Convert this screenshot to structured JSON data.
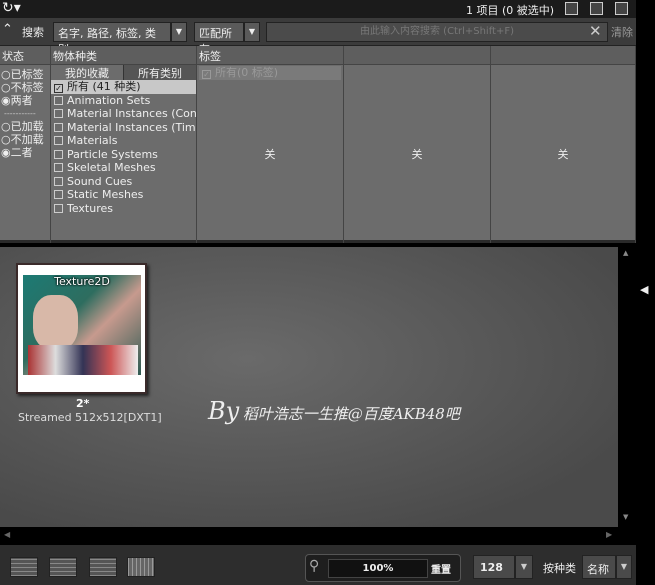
{
  "topbar": {
    "refresh_icon": "refresh-icon",
    "count": "1 项目 (0 被选中)"
  },
  "search": {
    "label": "搜索",
    "fields": "名字, 路径, 标签, 类别",
    "match": "匹配所有",
    "placeholder": "由此输入内容搜索 (Ctrl+Shift+F)",
    "clear": "清除"
  },
  "status": {
    "header": "状态",
    "tag_options": [
      "已标签",
      "不标签",
      "两者"
    ],
    "load_options": [
      "已加载",
      "不加载",
      "二者"
    ],
    "separator": "-----------"
  },
  "types": {
    "header": "物体种类",
    "tab_fav": "我的收藏",
    "tab_all": "所有类别",
    "items": [
      "所有 (41 种类)",
      "Animation Sets",
      "Material Instances (Consta",
      "Material Instances (Time V",
      "Materials",
      "Particle Systems",
      "Skeletal Meshes",
      "Sound Cues",
      "Static Meshes",
      "Textures"
    ]
  },
  "tags": {
    "header": "标签",
    "all": "所有(0 标签)",
    "off": "关"
  },
  "col4": {
    "off": "关"
  },
  "col5": {
    "off": "关"
  },
  "asset": {
    "overlay": "Texture2D",
    "name": "2*",
    "info": "Streamed 512x512[DXT1]"
  },
  "watermark": {
    "by": "By",
    "text": "稻叶浩志一生推@百度AKB48吧"
  },
  "bottom": {
    "zoom": "100%",
    "reset": "重置",
    "size": "128",
    "sort_label": "按种类",
    "sort_value": "名称"
  }
}
